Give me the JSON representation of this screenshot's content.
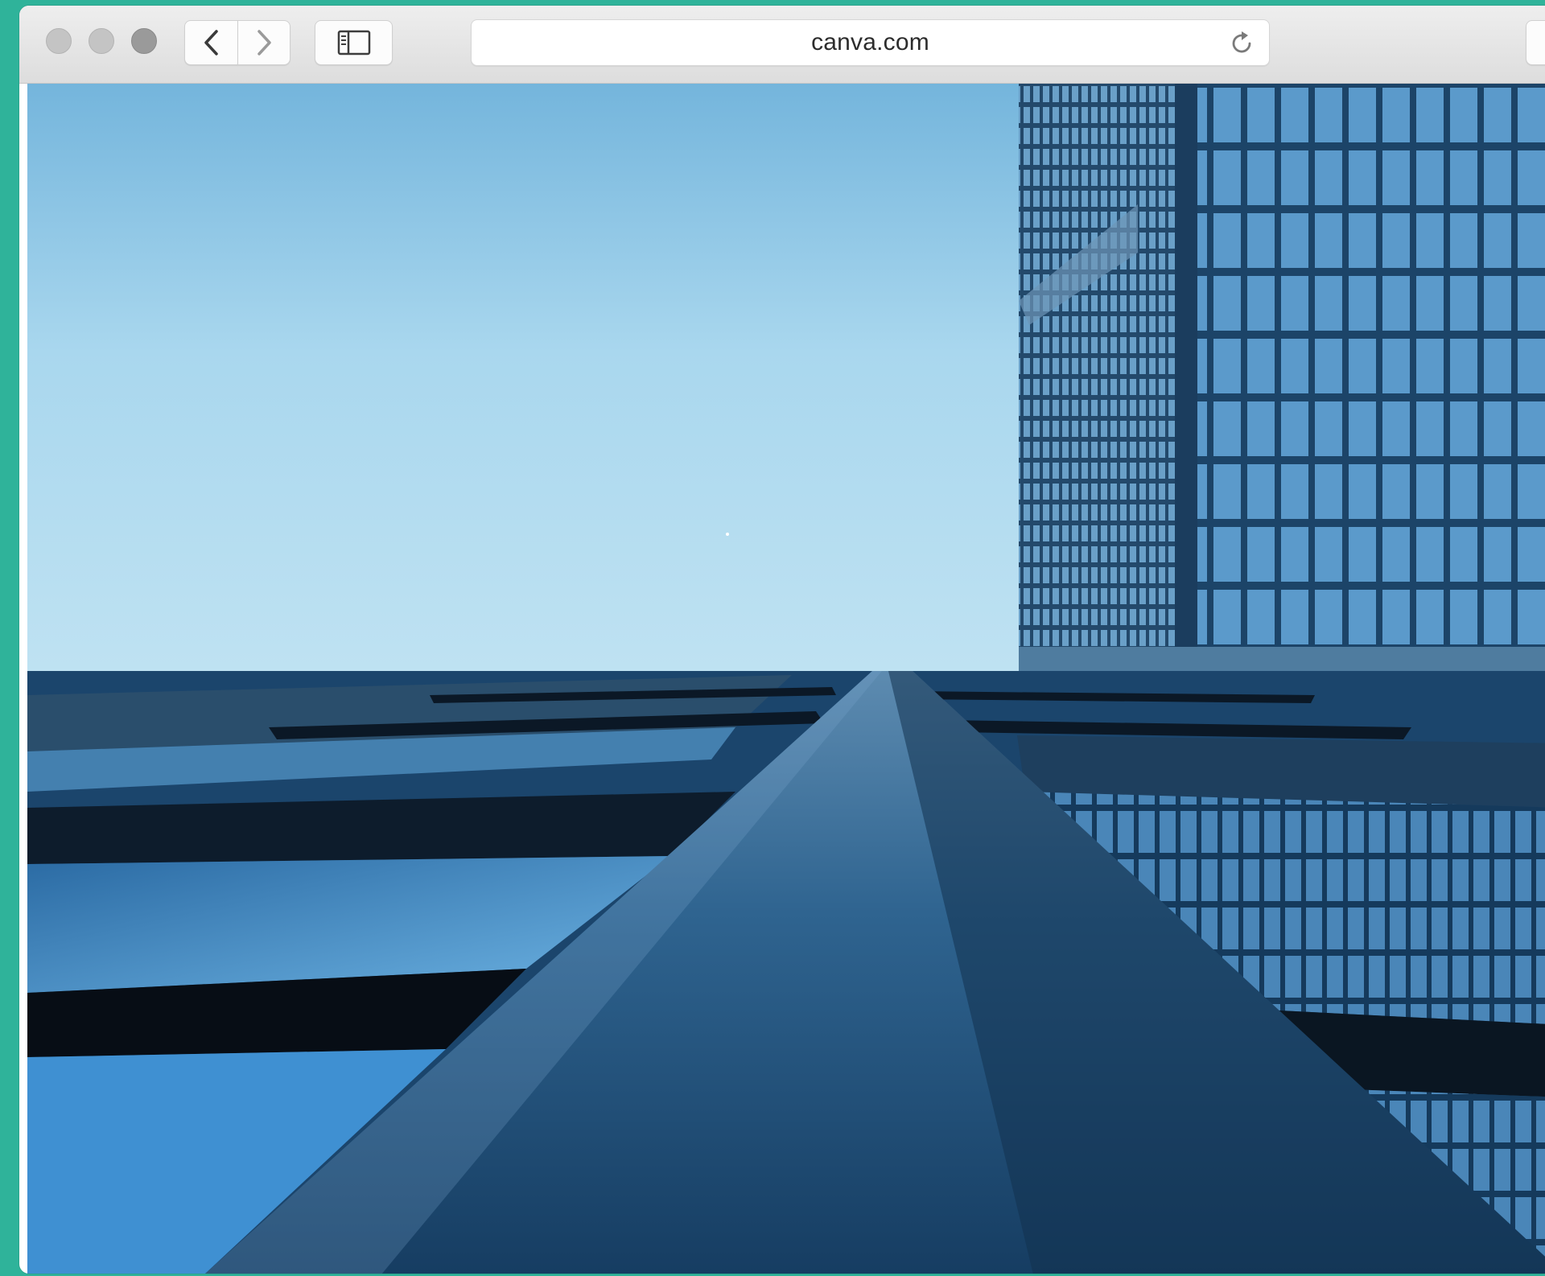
{
  "browser": {
    "url": "canva.com",
    "icons": {
      "close": "window-close-dot",
      "minimize": "window-minimize-dot",
      "zoom": "window-zoom-dot",
      "back": "chevron-left-icon",
      "forward": "chevron-right-icon",
      "sidebar": "sidebar-icon",
      "reload": "reload-icon"
    }
  },
  "page": {
    "image_subject": "architecture-photo"
  },
  "colors": {
    "desktop": "#2fb39a",
    "sky_top": "#7ab8dd",
    "sky_bottom": "#b9dff0",
    "building": "#1d4a6e",
    "glass": "#4a8fc4"
  }
}
